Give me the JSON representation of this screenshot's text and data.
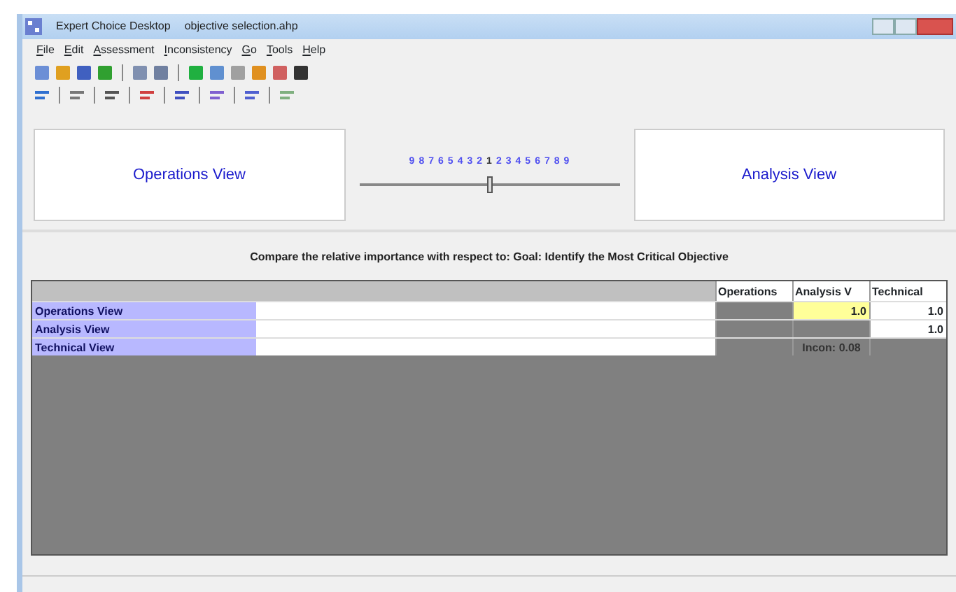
{
  "window": {
    "title": "Expert Choice Desktop",
    "document": "objective selection.ahp"
  },
  "menu": [
    {
      "label": "File"
    },
    {
      "label": "Edit"
    },
    {
      "label": "Assessment"
    },
    {
      "label": "Inconsistency"
    },
    {
      "label": "Go"
    },
    {
      "label": "Tools"
    },
    {
      "label": "Help"
    }
  ],
  "compare": {
    "left": "Operations View",
    "right": "Analysis View",
    "scale": [
      "9",
      "8",
      "7",
      "6",
      "5",
      "4",
      "3",
      "2",
      "1",
      "2",
      "3",
      "4",
      "5",
      "6",
      "7",
      "8",
      "9"
    ],
    "level": 0.5
  },
  "prompt": "Compare the relative importance with respect to: Goal: Identify the Most Critical Objective",
  "matrix": {
    "columns": [
      "Operations",
      "Analysis V",
      "Technical"
    ],
    "rows": [
      {
        "label": "Operations View",
        "cells": [
          {
            "kind": "empty"
          },
          {
            "kind": "value",
            "text": "1.0",
            "selected": true
          },
          {
            "kind": "value",
            "text": "1.0",
            "selected": false
          }
        ]
      },
      {
        "label": "Analysis View",
        "cells": [
          {
            "kind": "empty"
          },
          {
            "kind": "empty"
          },
          {
            "kind": "value",
            "text": "1.0",
            "selected": false
          }
        ]
      },
      {
        "label": "Technical View",
        "cells": [
          {
            "kind": "empty"
          },
          {
            "kind": "note",
            "text": "Incon: 0.08"
          },
          {
            "kind": "empty"
          }
        ]
      }
    ]
  }
}
